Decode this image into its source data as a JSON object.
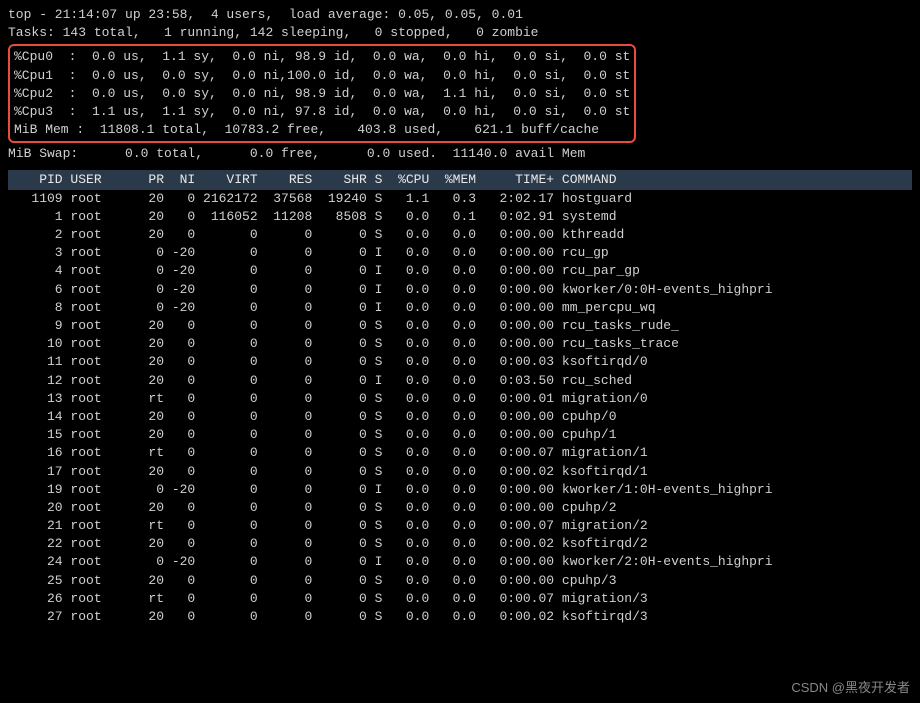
{
  "summary": {
    "line1": "top - 21:14:07 up 23:58,  4 users,  load average: 0.05, 0.05, 0.01",
    "line2": "Tasks: 143 total,   1 running, 142 sleeping,   0 stopped,   0 zombie",
    "cpu0": "%Cpu0  :  0.0 us,  1.1 sy,  0.0 ni, 98.9 id,  0.0 wa,  0.0 hi,  0.0 si,  0.0 st",
    "cpu1": "%Cpu1  :  0.0 us,  0.0 sy,  0.0 ni,100.0 id,  0.0 wa,  0.0 hi,  0.0 si,  0.0 st",
    "cpu2": "%Cpu2  :  0.0 us,  0.0 sy,  0.0 ni, 98.9 id,  0.0 wa,  1.1 hi,  0.0 si,  0.0 st",
    "cpu3": "%Cpu3  :  1.1 us,  1.1 sy,  0.0 ni, 97.8 id,  0.0 wa,  0.0 hi,  0.0 si,  0.0 st",
    "mem": "MiB Mem :  11808.1 total,  10783.2 free,    403.8 used,    621.1 buff/cache",
    "swap": "MiB Swap:      0.0 total,      0.0 free,      0.0 used.  11140.0 avail Mem"
  },
  "columns": [
    "PID",
    "USER",
    "PR",
    "NI",
    "VIRT",
    "RES",
    "SHR",
    "S",
    "%CPU",
    "%MEM",
    "TIME+",
    "COMMAND"
  ],
  "processes": [
    {
      "pid": "1109",
      "user": "root",
      "pr": "20",
      "ni": "0",
      "virt": "2162172",
      "res": "37568",
      "shr": "19240",
      "s": "S",
      "cpu": "1.1",
      "mem": "0.3",
      "time": "2:02.17",
      "cmd": "hostguard"
    },
    {
      "pid": "1",
      "user": "root",
      "pr": "20",
      "ni": "0",
      "virt": "116052",
      "res": "11208",
      "shr": "8508",
      "s": "S",
      "cpu": "0.0",
      "mem": "0.1",
      "time": "0:02.91",
      "cmd": "systemd"
    },
    {
      "pid": "2",
      "user": "root",
      "pr": "20",
      "ni": "0",
      "virt": "0",
      "res": "0",
      "shr": "0",
      "s": "S",
      "cpu": "0.0",
      "mem": "0.0",
      "time": "0:00.00",
      "cmd": "kthreadd"
    },
    {
      "pid": "3",
      "user": "root",
      "pr": "0",
      "ni": "-20",
      "virt": "0",
      "res": "0",
      "shr": "0",
      "s": "I",
      "cpu": "0.0",
      "mem": "0.0",
      "time": "0:00.00",
      "cmd": "rcu_gp"
    },
    {
      "pid": "4",
      "user": "root",
      "pr": "0",
      "ni": "-20",
      "virt": "0",
      "res": "0",
      "shr": "0",
      "s": "I",
      "cpu": "0.0",
      "mem": "0.0",
      "time": "0:00.00",
      "cmd": "rcu_par_gp"
    },
    {
      "pid": "6",
      "user": "root",
      "pr": "0",
      "ni": "-20",
      "virt": "0",
      "res": "0",
      "shr": "0",
      "s": "I",
      "cpu": "0.0",
      "mem": "0.0",
      "time": "0:00.00",
      "cmd": "kworker/0:0H-events_highpri"
    },
    {
      "pid": "8",
      "user": "root",
      "pr": "0",
      "ni": "-20",
      "virt": "0",
      "res": "0",
      "shr": "0",
      "s": "I",
      "cpu": "0.0",
      "mem": "0.0",
      "time": "0:00.00",
      "cmd": "mm_percpu_wq"
    },
    {
      "pid": "9",
      "user": "root",
      "pr": "20",
      "ni": "0",
      "virt": "0",
      "res": "0",
      "shr": "0",
      "s": "S",
      "cpu": "0.0",
      "mem": "0.0",
      "time": "0:00.00",
      "cmd": "rcu_tasks_rude_"
    },
    {
      "pid": "10",
      "user": "root",
      "pr": "20",
      "ni": "0",
      "virt": "0",
      "res": "0",
      "shr": "0",
      "s": "S",
      "cpu": "0.0",
      "mem": "0.0",
      "time": "0:00.00",
      "cmd": "rcu_tasks_trace"
    },
    {
      "pid": "11",
      "user": "root",
      "pr": "20",
      "ni": "0",
      "virt": "0",
      "res": "0",
      "shr": "0",
      "s": "S",
      "cpu": "0.0",
      "mem": "0.0",
      "time": "0:00.03",
      "cmd": "ksoftirqd/0"
    },
    {
      "pid": "12",
      "user": "root",
      "pr": "20",
      "ni": "0",
      "virt": "0",
      "res": "0",
      "shr": "0",
      "s": "I",
      "cpu": "0.0",
      "mem": "0.0",
      "time": "0:03.50",
      "cmd": "rcu_sched"
    },
    {
      "pid": "13",
      "user": "root",
      "pr": "rt",
      "ni": "0",
      "virt": "0",
      "res": "0",
      "shr": "0",
      "s": "S",
      "cpu": "0.0",
      "mem": "0.0",
      "time": "0:00.01",
      "cmd": "migration/0"
    },
    {
      "pid": "14",
      "user": "root",
      "pr": "20",
      "ni": "0",
      "virt": "0",
      "res": "0",
      "shr": "0",
      "s": "S",
      "cpu": "0.0",
      "mem": "0.0",
      "time": "0:00.00",
      "cmd": "cpuhp/0"
    },
    {
      "pid": "15",
      "user": "root",
      "pr": "20",
      "ni": "0",
      "virt": "0",
      "res": "0",
      "shr": "0",
      "s": "S",
      "cpu": "0.0",
      "mem": "0.0",
      "time": "0:00.00",
      "cmd": "cpuhp/1"
    },
    {
      "pid": "16",
      "user": "root",
      "pr": "rt",
      "ni": "0",
      "virt": "0",
      "res": "0",
      "shr": "0",
      "s": "S",
      "cpu": "0.0",
      "mem": "0.0",
      "time": "0:00.07",
      "cmd": "migration/1"
    },
    {
      "pid": "17",
      "user": "root",
      "pr": "20",
      "ni": "0",
      "virt": "0",
      "res": "0",
      "shr": "0",
      "s": "S",
      "cpu": "0.0",
      "mem": "0.0",
      "time": "0:00.02",
      "cmd": "ksoftirqd/1"
    },
    {
      "pid": "19",
      "user": "root",
      "pr": "0",
      "ni": "-20",
      "virt": "0",
      "res": "0",
      "shr": "0",
      "s": "I",
      "cpu": "0.0",
      "mem": "0.0",
      "time": "0:00.00",
      "cmd": "kworker/1:0H-events_highpri"
    },
    {
      "pid": "20",
      "user": "root",
      "pr": "20",
      "ni": "0",
      "virt": "0",
      "res": "0",
      "shr": "0",
      "s": "S",
      "cpu": "0.0",
      "mem": "0.0",
      "time": "0:00.00",
      "cmd": "cpuhp/2"
    },
    {
      "pid": "21",
      "user": "root",
      "pr": "rt",
      "ni": "0",
      "virt": "0",
      "res": "0",
      "shr": "0",
      "s": "S",
      "cpu": "0.0",
      "mem": "0.0",
      "time": "0:00.07",
      "cmd": "migration/2"
    },
    {
      "pid": "22",
      "user": "root",
      "pr": "20",
      "ni": "0",
      "virt": "0",
      "res": "0",
      "shr": "0",
      "s": "S",
      "cpu": "0.0",
      "mem": "0.0",
      "time": "0:00.02",
      "cmd": "ksoftirqd/2"
    },
    {
      "pid": "24",
      "user": "root",
      "pr": "0",
      "ni": "-20",
      "virt": "0",
      "res": "0",
      "shr": "0",
      "s": "I",
      "cpu": "0.0",
      "mem": "0.0",
      "time": "0:00.00",
      "cmd": "kworker/2:0H-events_highpri"
    },
    {
      "pid": "25",
      "user": "root",
      "pr": "20",
      "ni": "0",
      "virt": "0",
      "res": "0",
      "shr": "0",
      "s": "S",
      "cpu": "0.0",
      "mem": "0.0",
      "time": "0:00.00",
      "cmd": "cpuhp/3"
    },
    {
      "pid": "26",
      "user": "root",
      "pr": "rt",
      "ni": "0",
      "virt": "0",
      "res": "0",
      "shr": "0",
      "s": "S",
      "cpu": "0.0",
      "mem": "0.0",
      "time": "0:00.07",
      "cmd": "migration/3"
    },
    {
      "pid": "27",
      "user": "root",
      "pr": "20",
      "ni": "0",
      "virt": "0",
      "res": "0",
      "shr": "0",
      "s": "S",
      "cpu": "0.0",
      "mem": "0.0",
      "time": "0:00.02",
      "cmd": "ksoftirqd/3"
    }
  ],
  "watermark": "CSDN @黑夜开发者"
}
